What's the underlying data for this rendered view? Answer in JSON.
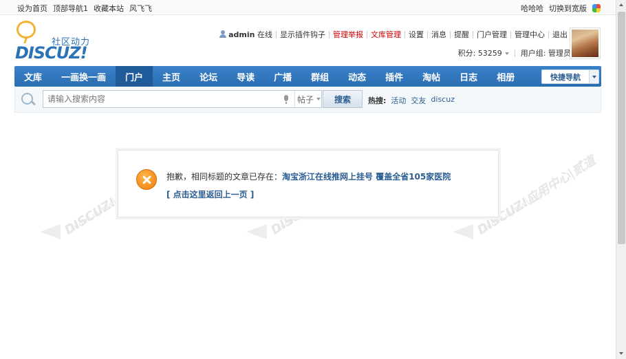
{
  "topbar": {
    "left_links": [
      "设为首页",
      "顶部导航1",
      "收藏本站",
      "风飞飞"
    ],
    "right_links": [
      "哈哈哈",
      "切换到宽版"
    ],
    "theme_icon": "theme-color-icon"
  },
  "logo": {
    "slogan": "社区动力",
    "wordmark": "DISCUZ!"
  },
  "usernav": {
    "username": "admin",
    "status": "在线",
    "links": [
      "显示插件钩子",
      "管理举报",
      "文库管理",
      "设置",
      "消息",
      "提醒",
      "门户管理",
      "管理中心",
      "退出"
    ],
    "highlight_color": "#cc0000"
  },
  "credits": {
    "label": "积分: 53259",
    "group": "用户组: 管理员"
  },
  "nav": {
    "items": [
      "文库",
      "一画换一画",
      "门户",
      "主页",
      "论坛",
      "导读",
      "广播",
      "群组",
      "动态",
      "插件",
      "淘帖",
      "日志",
      "相册"
    ],
    "active": "门户",
    "quicknav_label": "快捷导航",
    "accent": "#2b6db1"
  },
  "search": {
    "placeholder": "请输入搜索内容",
    "scope": "帖子",
    "button": "搜索",
    "hot_label": "热搜:",
    "hot_terms": [
      "活动",
      "交友",
      "discuz"
    ]
  },
  "notice": {
    "prefix": "抱歉，相同标题的文章已存在：",
    "title": "淘宝浙江在线推网上挂号 覆盖全省105家医院",
    "back_link": "[ 点击这里返回上一页 ]",
    "icon": "error-icon"
  }
}
